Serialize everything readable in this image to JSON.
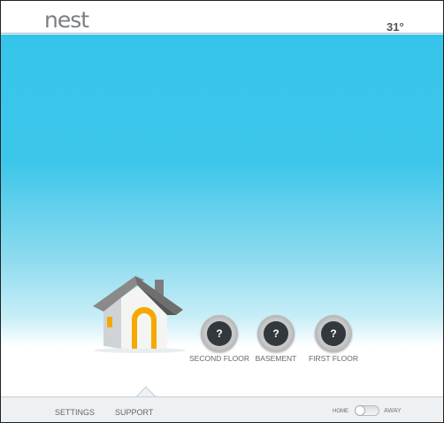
{
  "header": {
    "logo": "nest",
    "temperature": "31°"
  },
  "thermostats": [
    {
      "label": "SECOND FLOOR",
      "value": "?"
    },
    {
      "label": "BASEMENT",
      "value": "?"
    },
    {
      "label": "FIRST FLOOR",
      "value": "?"
    }
  ],
  "footer": {
    "settings": "SETTINGS",
    "support": "SUPPORT",
    "home": "HOME",
    "away": "AWAY",
    "away_mode": "home"
  },
  "colors": {
    "sky": "#36c5ea",
    "accent": "#f5a800"
  }
}
